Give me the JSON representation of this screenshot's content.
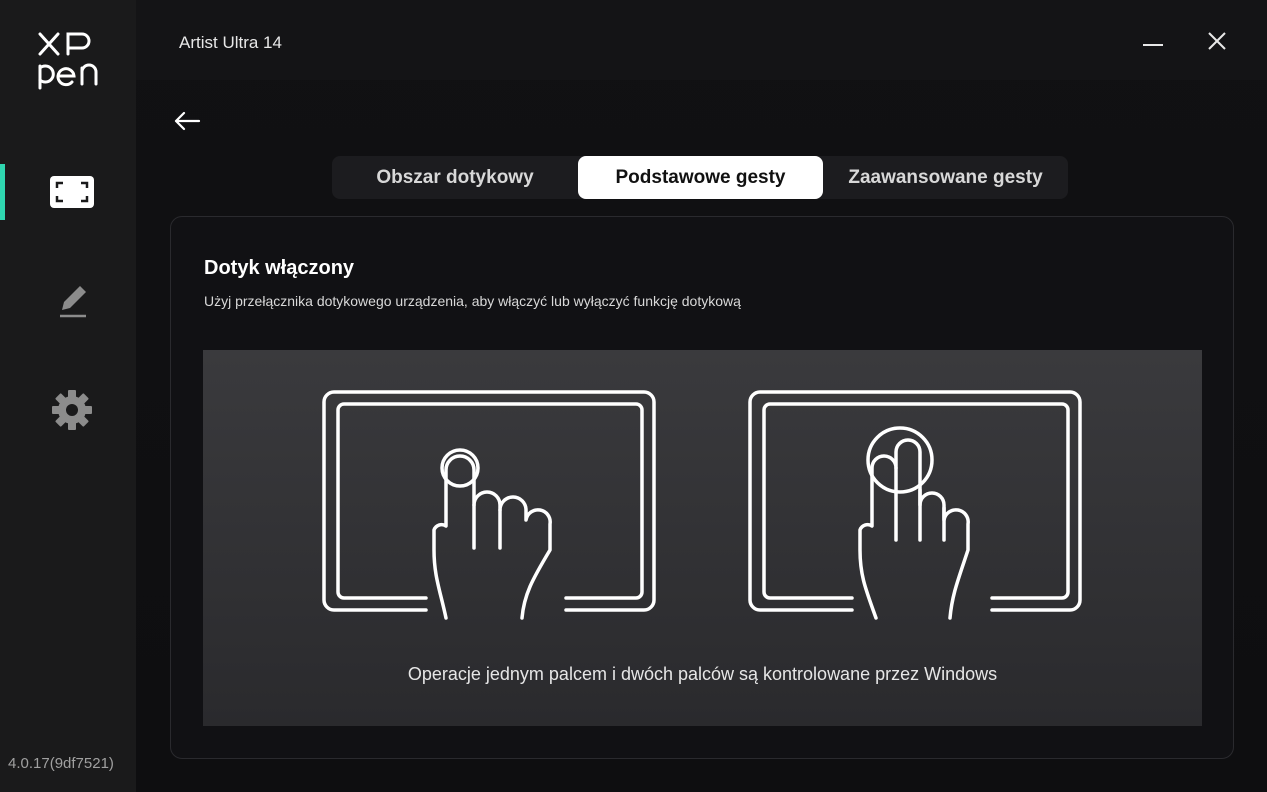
{
  "app": {
    "logo": "XP pen",
    "window_title": "Artist Ultra 14",
    "version": "4.0.17(9df7521)"
  },
  "sidebar": {
    "items": [
      {
        "name": "display-area",
        "icon": "screen-area-icon",
        "active": true
      },
      {
        "name": "pen",
        "icon": "pen-icon",
        "active": false
      },
      {
        "name": "settings",
        "icon": "gear-icon",
        "active": false
      }
    ]
  },
  "window_controls": {
    "minimize_icon": "minimize-icon",
    "close_icon": "close-icon"
  },
  "nav": {
    "back_icon": "arrow-left-icon"
  },
  "tabs": [
    {
      "label": "Obszar dotykowy",
      "active": false
    },
    {
      "label": "Podstawowe gesty",
      "active": true
    },
    {
      "label": "Zaawansowane gesty",
      "active": false
    }
  ],
  "card": {
    "title": "Dotyk włączony",
    "subtitle": "Użyj przełącznika dotykowego urządzenia, aby włączyć lub wyłączyć funkcję dotykową",
    "caption": "Operacje jednym palcem i dwóch palców są kontrolowane przez Windows"
  },
  "colors": {
    "accent": "#2fd6b0",
    "background": "#0b0b0c",
    "sidebar": "#1a1a1b"
  }
}
